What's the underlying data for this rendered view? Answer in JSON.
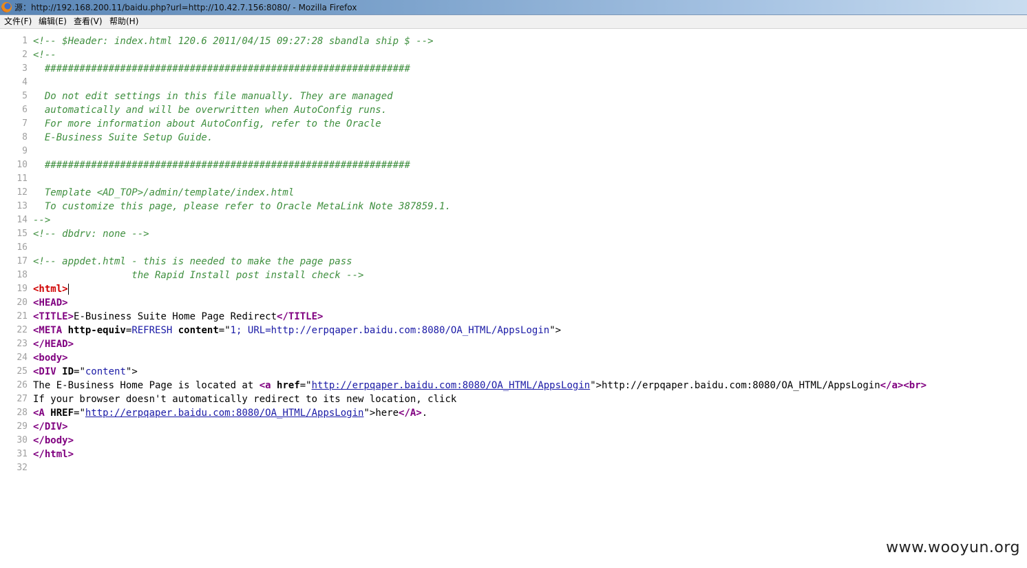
{
  "window": {
    "title": "源：http://192.168.200.11/baidu.php?url=http://10.42.7.156:8080/ - Mozilla Firefox"
  },
  "menu": {
    "file": "文件(F)",
    "edit": "编辑(E)",
    "view": "查看(V)",
    "help": "帮助(H)"
  },
  "colors": {
    "comment": "#3f8f3f",
    "tag": "#800080",
    "root_tag": "#d00000",
    "attr_value": "#1a1aa6",
    "line_number": "#a0a0a0"
  },
  "source_lines": [
    {
      "n": "1",
      "parts": [
        {
          "t": "<!-- $Header: index.html 120.6 2011/04/15 09:27:28 sbandla ship $ -->",
          "c": "cm"
        }
      ]
    },
    {
      "n": "2",
      "parts": [
        {
          "t": "<!--",
          "c": "cm"
        }
      ]
    },
    {
      "n": "3",
      "parts": [
        {
          "t": "  ###############################################################",
          "c": "cm"
        }
      ]
    },
    {
      "n": "4",
      "parts": []
    },
    {
      "n": "5",
      "parts": [
        {
          "t": "  Do not edit settings in this file manually. They are managed",
          "c": "cm"
        }
      ]
    },
    {
      "n": "6",
      "parts": [
        {
          "t": "  automatically and will be overwritten when AutoConfig runs.",
          "c": "cm"
        }
      ]
    },
    {
      "n": "7",
      "parts": [
        {
          "t": "  For more information about AutoConfig, refer to the Oracle",
          "c": "cm"
        }
      ]
    },
    {
      "n": "8",
      "parts": [
        {
          "t": "  E-Business Suite Setup Guide.",
          "c": "cm"
        }
      ]
    },
    {
      "n": "9",
      "parts": []
    },
    {
      "n": "10",
      "parts": [
        {
          "t": "  ###############################################################",
          "c": "cm"
        }
      ]
    },
    {
      "n": "11",
      "parts": []
    },
    {
      "n": "12",
      "parts": [
        {
          "t": "  Template <AD_TOP>/admin/template/index.html",
          "c": "cm"
        }
      ]
    },
    {
      "n": "13",
      "parts": [
        {
          "t": "  To customize this page, please refer to Oracle MetaLink Note 387859.1.",
          "c": "cm"
        }
      ]
    },
    {
      "n": "14",
      "parts": [
        {
          "t": "-->",
          "c": "cm"
        }
      ]
    },
    {
      "n": "15",
      "parts": [
        {
          "t": "<!-- dbdrv: none -->",
          "c": "cm"
        }
      ]
    },
    {
      "n": "16",
      "parts": []
    },
    {
      "n": "17",
      "parts": [
        {
          "t": "<!-- appdet.html - this is needed to make the page pass",
          "c": "cm"
        }
      ]
    },
    {
      "n": "18",
      "parts": [
        {
          "t": "                 the Rapid Install post install check -->",
          "c": "cm"
        }
      ]
    },
    {
      "n": "19",
      "parts": [
        {
          "t": "<html>",
          "c": "rt"
        }
      ],
      "caret": true
    },
    {
      "n": "20",
      "parts": [
        {
          "t": "<",
          "c": "tg"
        },
        {
          "t": "HEAD",
          "c": "tg"
        },
        {
          "t": ">",
          "c": "tg"
        }
      ]
    },
    {
      "n": "21",
      "parts": [
        {
          "t": "<TITLE>",
          "c": "tg"
        },
        {
          "t": "E-Business Suite Home Page Redirect",
          "c": "pl"
        },
        {
          "t": "</TITLE>",
          "c": "tg"
        }
      ]
    },
    {
      "n": "22",
      "parts": [
        {
          "t": "<META ",
          "c": "tg"
        },
        {
          "t": "http-equiv",
          "c": "at"
        },
        {
          "t": "=",
          "c": "pl"
        },
        {
          "t": "REFRESH",
          "c": "vl"
        },
        {
          "t": " content",
          "c": "at"
        },
        {
          "t": "=\"",
          "c": "pl"
        },
        {
          "t": "1; URL=http://erpqaper.baidu.com:8080/OA_HTML/AppsLogin",
          "c": "vl"
        },
        {
          "t": "\">",
          "c": "pl"
        }
      ]
    },
    {
      "n": "23",
      "parts": [
        {
          "t": "</HEAD>",
          "c": "tg"
        }
      ]
    },
    {
      "n": "24",
      "parts": [
        {
          "t": "<body>",
          "c": "tg"
        }
      ]
    },
    {
      "n": "25",
      "parts": [
        {
          "t": "<DIV ",
          "c": "tg"
        },
        {
          "t": "ID",
          "c": "at"
        },
        {
          "t": "=\"",
          "c": "pl"
        },
        {
          "t": "content",
          "c": "vl"
        },
        {
          "t": "\">",
          "c": "pl"
        }
      ]
    },
    {
      "n": "26",
      "parts": [
        {
          "t": "The E-Business Home Page is located at ",
          "c": "pl"
        },
        {
          "t": "<a ",
          "c": "tg"
        },
        {
          "t": "href",
          "c": "at"
        },
        {
          "t": "=\"",
          "c": "pl"
        },
        {
          "t": "http://erpqaper.baidu.com:8080/OA_HTML/AppsLogin",
          "c": "lk"
        },
        {
          "t": "\">",
          "c": "pl"
        },
        {
          "t": "http://erpqaper.baidu.com:8080/OA_HTML/AppsLogin",
          "c": "pl"
        },
        {
          "t": "</a>",
          "c": "tg"
        },
        {
          "t": "<br>",
          "c": "tg"
        }
      ]
    },
    {
      "n": "27",
      "parts": [
        {
          "t": "If your browser doesn't automatically redirect to its new location, click",
          "c": "pl"
        }
      ]
    },
    {
      "n": "28",
      "parts": [
        {
          "t": "<A ",
          "c": "tg"
        },
        {
          "t": "HREF",
          "c": "at"
        },
        {
          "t": "=\"",
          "c": "pl"
        },
        {
          "t": "http://erpqaper.baidu.com:8080/OA_HTML/AppsLogin",
          "c": "lk"
        },
        {
          "t": "\">",
          "c": "pl"
        },
        {
          "t": "here",
          "c": "pl"
        },
        {
          "t": "</A>",
          "c": "tg"
        },
        {
          "t": ".",
          "c": "pl"
        }
      ]
    },
    {
      "n": "29",
      "parts": [
        {
          "t": "</DIV>",
          "c": "tg"
        }
      ]
    },
    {
      "n": "30",
      "parts": [
        {
          "t": "</body>",
          "c": "tg"
        }
      ]
    },
    {
      "n": "31",
      "parts": [
        {
          "t": "</html>",
          "c": "tg"
        }
      ]
    },
    {
      "n": "32",
      "parts": []
    }
  ],
  "watermark": "www.wooyun.org"
}
